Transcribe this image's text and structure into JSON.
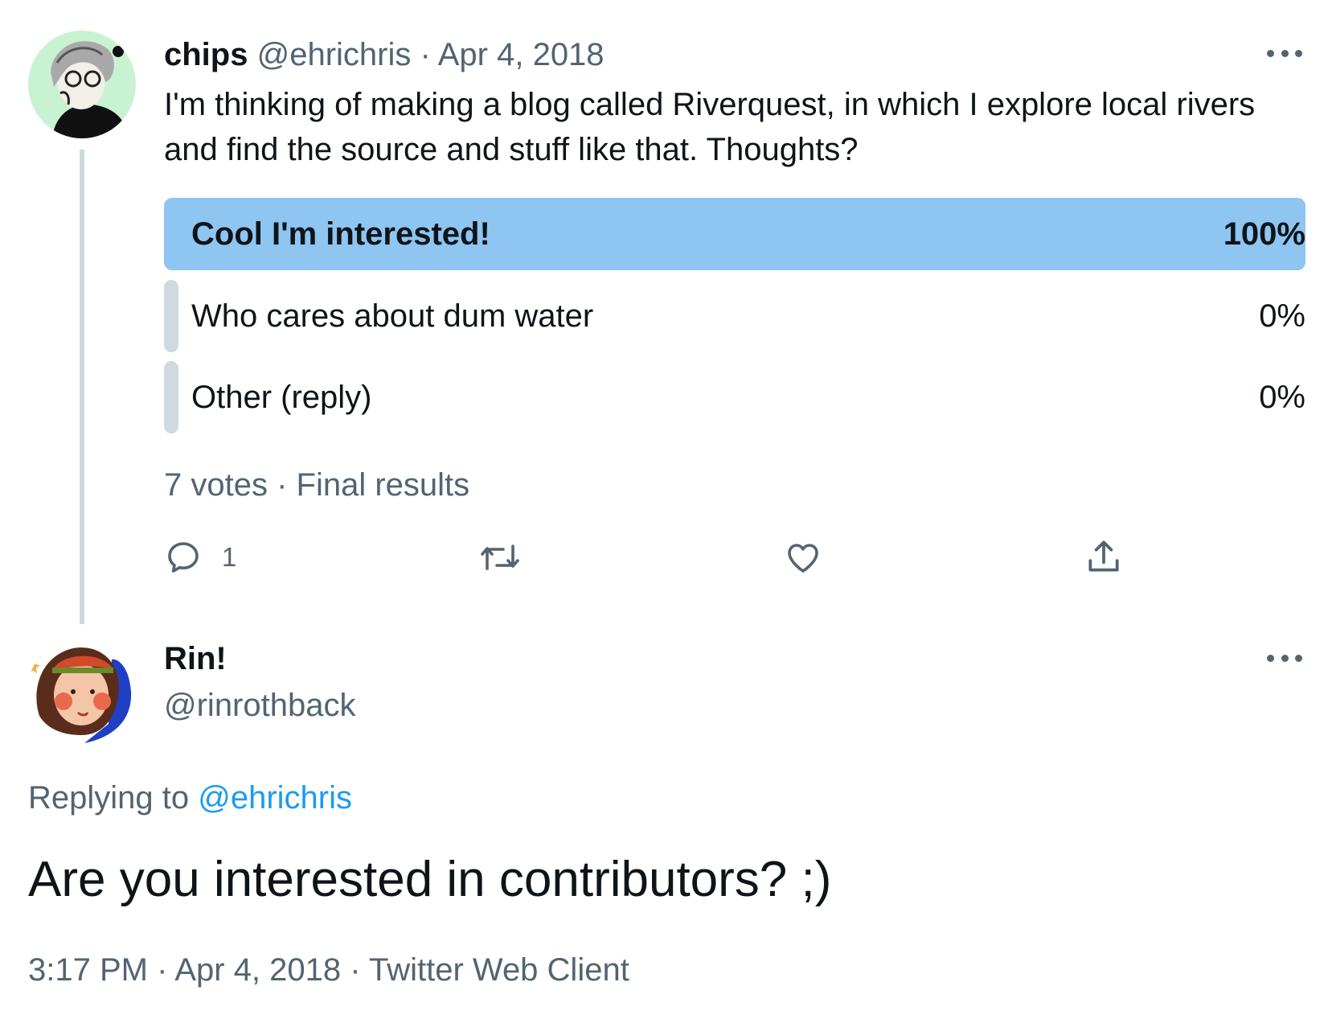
{
  "tweet": {
    "author_name": "chips",
    "author_handle": "@ehrichris",
    "separator": "·",
    "date": "Apr 4, 2018",
    "text": "I'm thinking of making a blog called Riverquest, in which I explore local rivers and find the source and stuff like that. Thoughts?",
    "poll": {
      "options": [
        {
          "label": "Cool I'm interested!",
          "percent_text": "100%",
          "percent": 100,
          "winner": true
        },
        {
          "label": "Who cares about dum water",
          "percent_text": "0%",
          "percent": 0,
          "winner": false
        },
        {
          "label": "Other (reply)",
          "percent_text": "0%",
          "percent": 0,
          "winner": false
        }
      ],
      "votes": "7 votes",
      "status": "Final results"
    },
    "actions": {
      "reply_count": "1"
    }
  },
  "reply": {
    "author_name": "Rin!",
    "author_handle": "@rinrothback",
    "replying_prefix": "Replying to",
    "replying_to": "@ehrichris",
    "text": "Are you interested in contributors? ;)",
    "time": "3:17 PM",
    "date": "Apr 4, 2018",
    "client": "Twitter Web Client"
  },
  "colors": {
    "winner_fill": "#8ec5f1",
    "loser_fill": "#cfd9de",
    "link": "#1d9bf0",
    "secondary_text": "#536471"
  },
  "icons": [
    "more-icon",
    "reply-icon",
    "retweet-icon",
    "like-icon",
    "share-icon"
  ]
}
